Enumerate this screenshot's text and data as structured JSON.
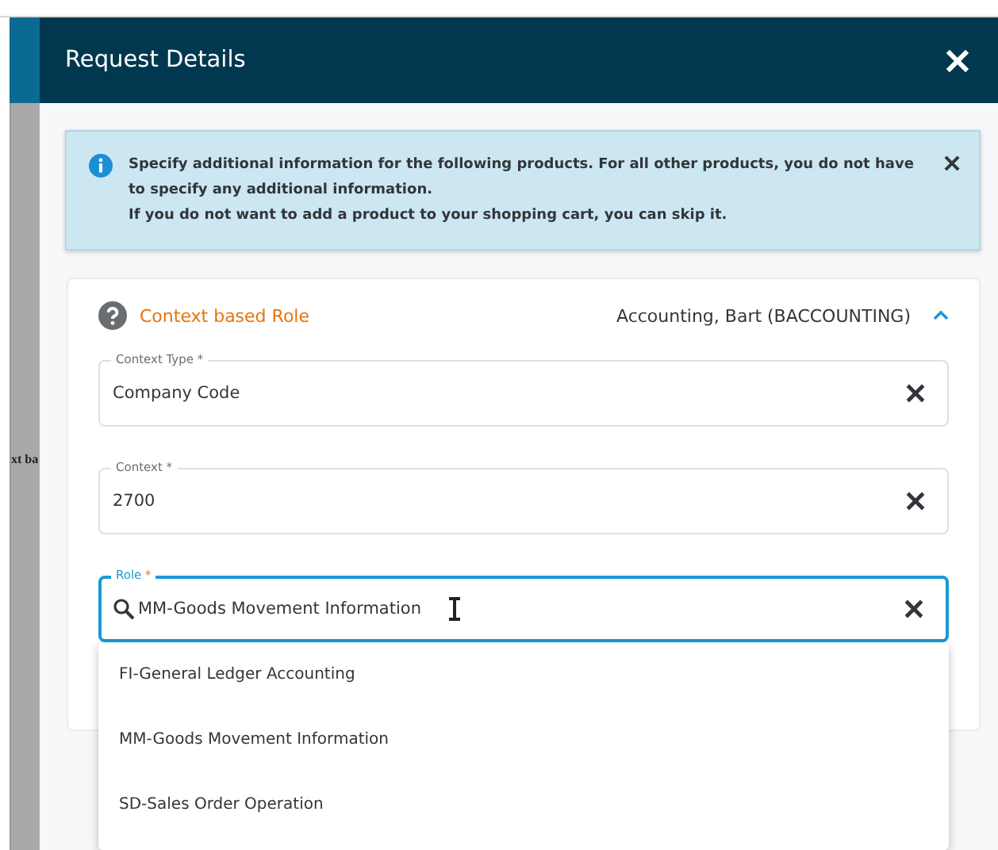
{
  "background": {
    "text": "xt ba"
  },
  "dialog": {
    "title": "Request Details"
  },
  "banner": {
    "lines": [
      "Specify additional information for the following products. For all other products, you do not have to specify any additional information.",
      "If you do not want to add a product to your shopping cart, you can skip it."
    ]
  },
  "section": {
    "title": "Context based Role",
    "user": "Accounting, Bart (BACCOUNTING)",
    "expanded": true,
    "fields": [
      {
        "label": "Context Type",
        "required_mark": "*",
        "value": "Company Code",
        "focused": false,
        "kind": "plain"
      },
      {
        "label": "Context",
        "required_mark": "*",
        "value": "2700",
        "focused": false,
        "kind": "plain"
      },
      {
        "label": "Role",
        "required_mark": "*",
        "value": "MM-Goods Movement Information",
        "focused": true,
        "kind": "search"
      }
    ]
  },
  "dropdown": {
    "options": [
      "FI-General Ledger Accounting",
      "MM-Goods Movement Information",
      "SD-Sales Order Operation"
    ]
  }
}
